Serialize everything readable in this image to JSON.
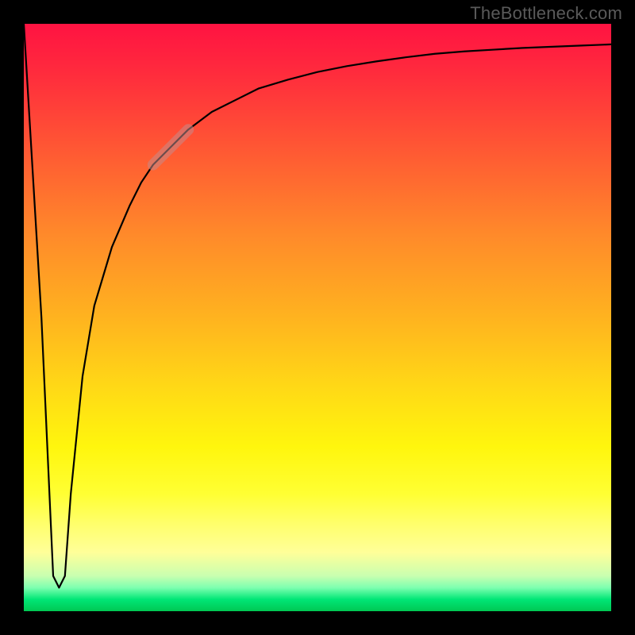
{
  "watermark": "TheBottleneck.com",
  "chart_data": {
    "type": "line",
    "title": "",
    "xlabel": "",
    "ylabel": "",
    "xlim": [
      0,
      100
    ],
    "ylim": [
      0,
      100
    ],
    "series": [
      {
        "name": "bottleneck-curve",
        "x": [
          0,
          3,
          5,
          6,
          7,
          8,
          10,
          12,
          15,
          18,
          20,
          22,
          25,
          28,
          32,
          36,
          40,
          45,
          50,
          55,
          60,
          65,
          70,
          75,
          80,
          85,
          90,
          95,
          100
        ],
        "values": [
          100,
          50,
          6,
          4,
          6,
          20,
          40,
          52,
          62,
          69,
          73,
          76,
          79,
          82,
          85,
          87,
          89,
          90.5,
          91.8,
          92.8,
          93.6,
          94.3,
          94.9,
          95.3,
          95.6,
          95.9,
          96.1,
          96.3,
          96.5
        ]
      }
    ],
    "highlight_segment": {
      "x_start": 22,
      "x_end": 28
    }
  },
  "colors": {
    "curve": "#000000",
    "highlight": "#000000",
    "highlight_opacity": 0.18,
    "watermark": "#5a5a5a"
  }
}
